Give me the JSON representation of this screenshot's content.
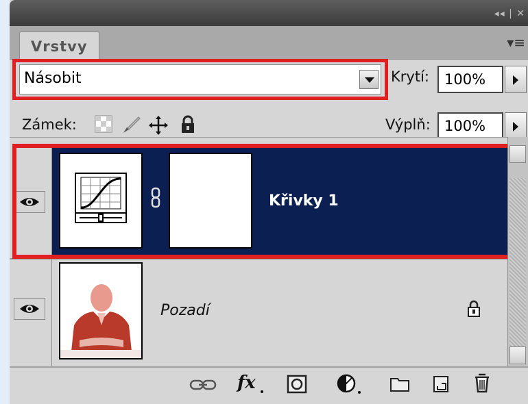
{
  "panel": {
    "tab_label": "Vrstvy",
    "topbar_controls": "◂◂ | ✕",
    "menu_icon": "▾≡"
  },
  "blend": {
    "mode_value": "Násobit",
    "opacity_label": "Krytí:",
    "opacity_value": "100%",
    "fill_label": "Výplň:",
    "fill_value": "100%"
  },
  "locks": {
    "label": "Zámek:"
  },
  "layers": [
    {
      "name": "Křivky 1",
      "selected": true,
      "visible": true,
      "type": "curves-adjustment"
    },
    {
      "name": "Pozadí",
      "selected": false,
      "visible": true,
      "type": "background",
      "locked": true
    }
  ],
  "colors": {
    "selected_layer_bg": "#0c1f52",
    "highlight_red": "#e02020",
    "panel_bg": "#d6d6d6"
  },
  "bottom_icons": [
    "link-layers-icon",
    "fx-icon",
    "layer-mask-icon",
    "adjustment-layer-icon",
    "group-folder-icon",
    "new-layer-icon",
    "trash-icon"
  ]
}
